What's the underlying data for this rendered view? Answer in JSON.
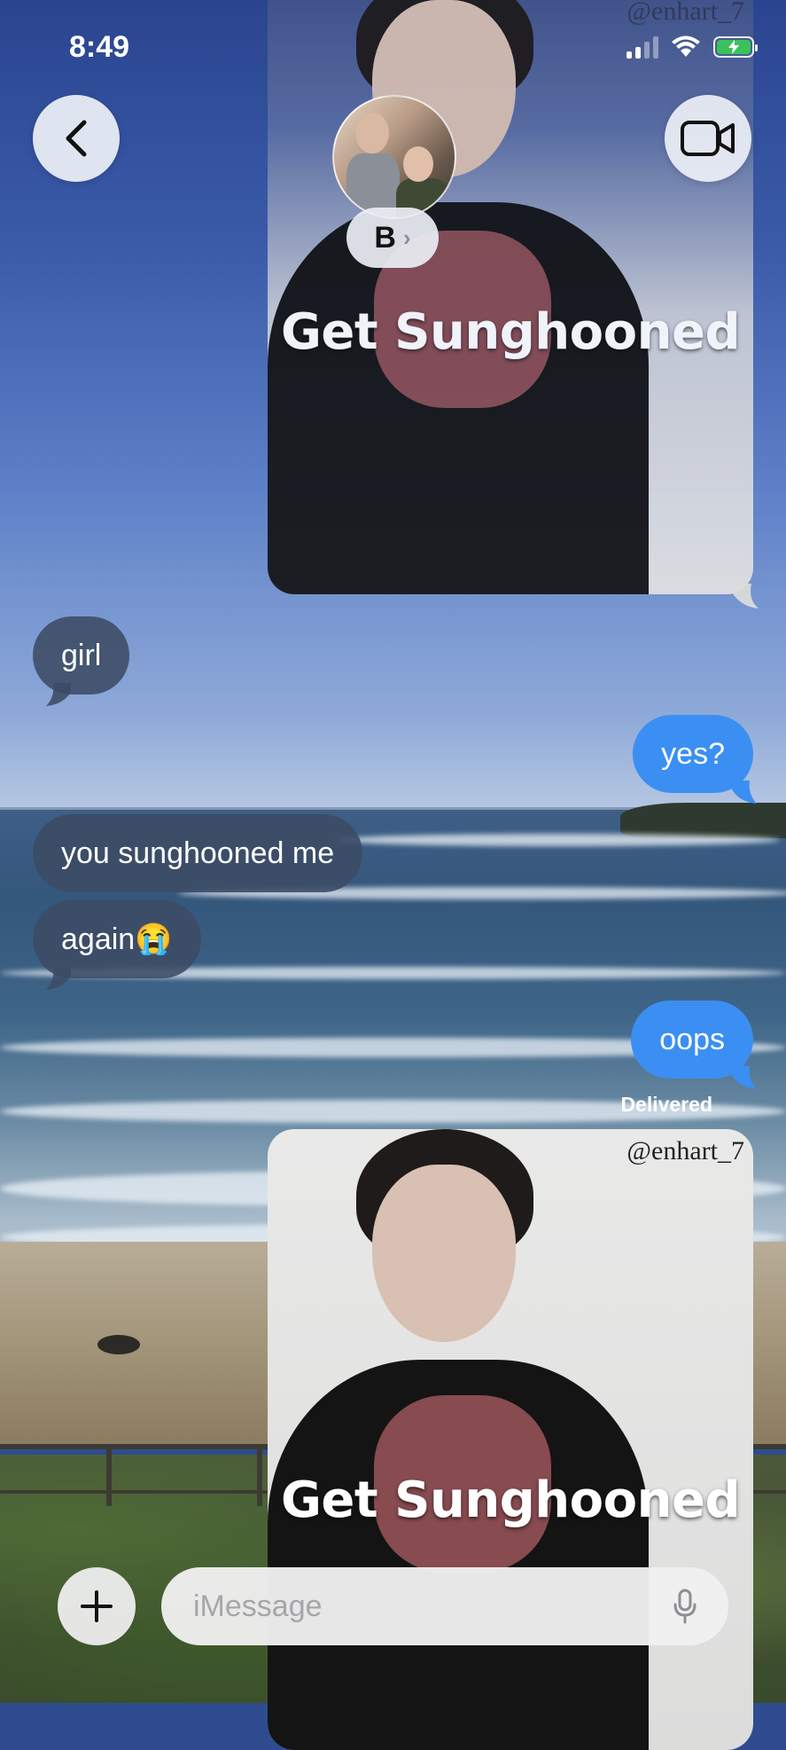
{
  "status_bar": {
    "time": "8:49",
    "signal_icon": "cellular-signal-icon",
    "wifi_icon": "wifi-icon",
    "battery_icon": "battery-charging-icon",
    "battery_color": "#3ac25a"
  },
  "header": {
    "back_icon": "chevron-left-icon",
    "contact_initial": "B",
    "contact_chevron": "›",
    "video_icon": "video-camera-icon"
  },
  "messages": [
    {
      "type": "media",
      "direction": "sent",
      "caption": "Get Sunghooned",
      "watermark": "@enhart_7"
    },
    {
      "type": "text",
      "direction": "received",
      "text": "girl"
    },
    {
      "type": "text",
      "direction": "sent",
      "text": "yes?"
    },
    {
      "type": "text",
      "direction": "received",
      "text": "you sunghooned me"
    },
    {
      "type": "text",
      "direction": "received",
      "text": "again😭"
    },
    {
      "type": "text",
      "direction": "sent",
      "text": "oops"
    },
    {
      "type": "media",
      "direction": "sent",
      "caption": "Get Sunghooned",
      "watermark": "@enhart_7"
    }
  ],
  "delivery_status": "Delivered",
  "composer": {
    "placeholder": "iMessage",
    "plus_icon": "plus-icon",
    "mic_icon": "microphone-icon"
  },
  "colors": {
    "sent_bubble": "#3b8ff2",
    "received_bubble": "#3c4b64"
  }
}
